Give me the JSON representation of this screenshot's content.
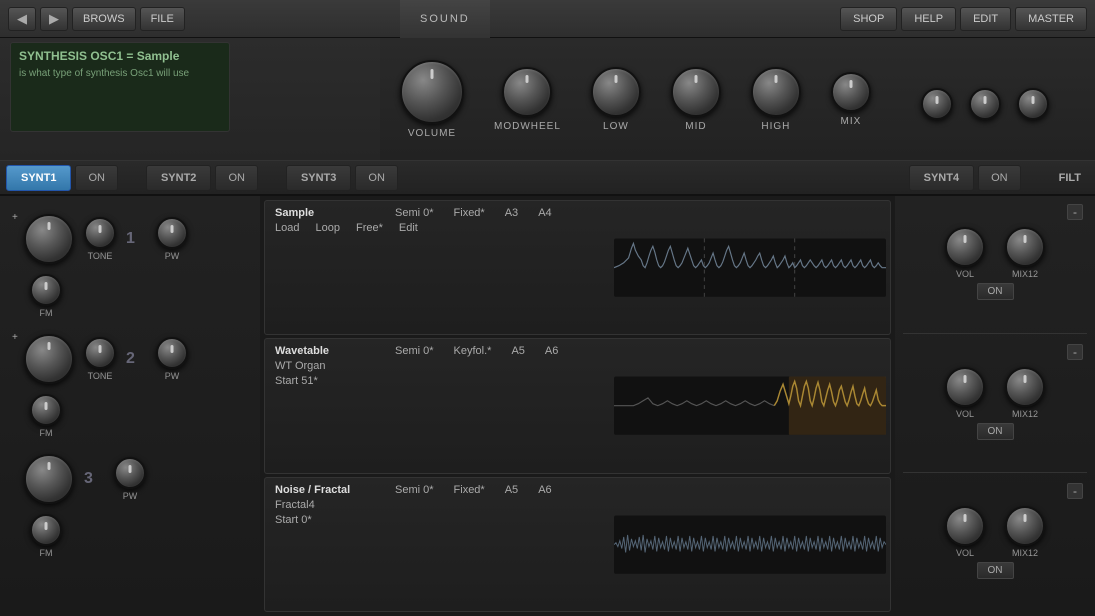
{
  "nav": {
    "back_arrow": "◀",
    "fwd_arrow": "▶",
    "browse_label": "BROWS",
    "file_label": "FILE",
    "sound_label": "SOUND",
    "shop_label": "SHOP",
    "help_label": "HELP",
    "edit_label": "EDIT",
    "master_label": "MASTER"
  },
  "info_panel": {
    "title": "SYNTHESIS OSC1 = Sample",
    "description": "is what type of synthesis Osc1 will use"
  },
  "knobs": {
    "volume_label": "VOLUME",
    "modwheel_label": "MODWHEEL",
    "low_label": "LOW",
    "mid_label": "MID",
    "high_label": "HIGH",
    "mix_label": "MIX"
  },
  "synt_tabs": [
    {
      "label": "SYNT1",
      "active": true
    },
    {
      "label": "ON",
      "active": false
    },
    {
      "label": "SYNT2",
      "active": false
    },
    {
      "label": "ON",
      "active": false
    },
    {
      "label": "SYNT3",
      "active": false
    },
    {
      "label": "ON",
      "active": false
    },
    {
      "label": "SYNT4",
      "active": false
    },
    {
      "label": "ON",
      "active": false
    }
  ],
  "filt_label": "FILT",
  "osc_groups": [
    {
      "number": "1",
      "tone_label": "TONE",
      "pw_label": "PW",
      "fm_label": "FM",
      "plus_label": "+"
    },
    {
      "number": "2",
      "tone_label": "TONE",
      "pw_label": "PW",
      "fm_label": "FM",
      "plus_label": "+"
    },
    {
      "number": "3",
      "pw_label": "PW",
      "fm_label": "FM"
    }
  ],
  "modules": [
    {
      "id": "module1",
      "type": "Sample",
      "semi": "Semi 0*",
      "fixed": "Fixed*",
      "note1": "A3",
      "note2": "A4",
      "sub1": "Load",
      "sub2": "Loop",
      "sub3": "Free*",
      "sub4": "Edit",
      "waveform_type": "sample"
    },
    {
      "id": "module2",
      "type": "Wavetable",
      "semi": "Semi 0*",
      "fixed": "Keyfol.*",
      "note1": "A5",
      "note2": "A6",
      "sub1": "WT Organ",
      "sub2": "",
      "sub3": "Start 51*",
      "sub4": "",
      "waveform_type": "wavetable"
    },
    {
      "id": "module3",
      "type": "Noise / Fractal",
      "semi": "Semi 0*",
      "fixed": "Fixed*",
      "note1": "A5",
      "note2": "A6",
      "sub1": "Fractal4",
      "sub2": "",
      "sub3": "Start 0*",
      "sub4": "",
      "waveform_type": "noise"
    }
  ],
  "right_panel": [
    {
      "vol_label": "VOL",
      "mix_label": "MIX12",
      "on_label": "ON",
      "minus": "-"
    },
    {
      "vol_label": "VOL",
      "mix_label": "MIX12",
      "on_label": "ON",
      "minus": "-"
    },
    {
      "vol_label": "VOL",
      "mix_label": "MIX12",
      "on_label": "ON",
      "minus": "-"
    }
  ],
  "colors": {
    "active_tab": "#5599cc",
    "bg_dark": "#1a1a1a",
    "bg_mid": "#252525",
    "knob_top": "#888",
    "knob_bot": "#333",
    "text_light": "#ddd",
    "text_mid": "#aaa",
    "info_text": "#8aba8a"
  }
}
